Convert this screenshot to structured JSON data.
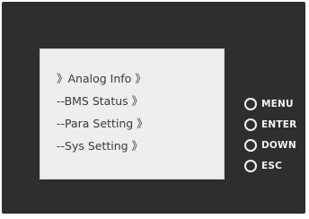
{
  "screen": {
    "menu": [
      {
        "label": "》Analog Info 》"
      },
      {
        "label": "--BMS Status 》"
      },
      {
        "label": "--Para Setting 》"
      },
      {
        "label": "--Sys Setting 》"
      }
    ]
  },
  "buttons": [
    {
      "label": "MENU",
      "icon": "circle-button-icon"
    },
    {
      "label": "ENTER",
      "icon": "circle-button-icon"
    },
    {
      "label": "DOWN",
      "icon": "circle-button-icon"
    },
    {
      "label": "ESC",
      "icon": "circle-button-icon"
    }
  ],
  "colors": {
    "panel": "#2e2e2e",
    "lcd_background": "#eeeeee",
    "lcd_text": "#3a3a3a",
    "button_text": "#f4f4f4"
  }
}
